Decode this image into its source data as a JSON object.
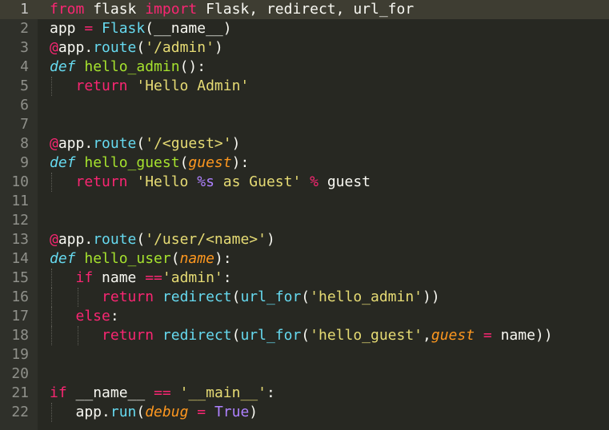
{
  "editor": {
    "active_line": 1,
    "theme_colors": {
      "background": "#272822",
      "keyword": "#f92672",
      "function": "#a6e22e",
      "string": "#e6db74",
      "builtin": "#66d9ef",
      "parameter": "#fd971f",
      "constant": "#ae81ff"
    },
    "lines": [
      {
        "n": "1",
        "indent": 0,
        "tokens": [
          [
            "kw",
            "from"
          ],
          [
            "",
            "flask"
          ],
          [
            "kw",
            "import"
          ],
          [
            "",
            "Flask, redirect, url_for"
          ]
        ]
      },
      {
        "n": "2",
        "indent": 0,
        "tokens": [
          [
            "",
            "app "
          ],
          [
            "kw",
            "="
          ],
          [
            "",
            " "
          ],
          [
            "bi",
            "Flask"
          ],
          [
            "",
            "(__name__)"
          ]
        ]
      },
      {
        "n": "3",
        "indent": 0,
        "tokens": [
          [
            "kw",
            "@"
          ],
          [
            "",
            "app."
          ],
          [
            "bi",
            "route"
          ],
          [
            "",
            "("
          ],
          [
            "st",
            "'/admin'"
          ],
          [
            "",
            ")"
          ]
        ]
      },
      {
        "n": "4",
        "indent": 0,
        "tokens": [
          [
            "ty",
            "def"
          ],
          [
            "",
            " "
          ],
          [
            "fn",
            "hello_admin"
          ],
          [
            "",
            "():"
          ]
        ]
      },
      {
        "n": "5",
        "indent": 1,
        "tokens": [
          [
            "kw",
            "return"
          ],
          [
            "",
            " "
          ],
          [
            "st",
            "'Hello Admin'"
          ]
        ]
      },
      {
        "n": "6",
        "indent": 0,
        "tokens": []
      },
      {
        "n": "7",
        "indent": 0,
        "tokens": []
      },
      {
        "n": "8",
        "indent": 0,
        "tokens": [
          [
            "kw",
            "@"
          ],
          [
            "",
            "app."
          ],
          [
            "bi",
            "route"
          ],
          [
            "",
            "("
          ],
          [
            "st",
            "'/<guest>'"
          ],
          [
            "",
            ")"
          ]
        ]
      },
      {
        "n": "9",
        "indent": 0,
        "tokens": [
          [
            "ty",
            "def"
          ],
          [
            "",
            " "
          ],
          [
            "fn",
            "hello_guest"
          ],
          [
            "",
            "("
          ],
          [
            "pa",
            "guest"
          ],
          [
            "",
            "):"
          ]
        ]
      },
      {
        "n": "10",
        "indent": 1,
        "tokens": [
          [
            "kw",
            "return"
          ],
          [
            "",
            " "
          ],
          [
            "st",
            "'Hello "
          ],
          [
            "nu",
            "%s"
          ],
          [
            "st",
            " as Guest'"
          ],
          [
            "",
            " "
          ],
          [
            "kw",
            "%"
          ],
          [
            "",
            " guest"
          ]
        ]
      },
      {
        "n": "11",
        "indent": 0,
        "tokens": []
      },
      {
        "n": "12",
        "indent": 0,
        "tokens": []
      },
      {
        "n": "13",
        "indent": 0,
        "tokens": [
          [
            "kw",
            "@"
          ],
          [
            "",
            "app."
          ],
          [
            "bi",
            "route"
          ],
          [
            "",
            "("
          ],
          [
            "st",
            "'/user/<name>'"
          ],
          [
            "",
            ")"
          ]
        ]
      },
      {
        "n": "14",
        "indent": 0,
        "tokens": [
          [
            "ty",
            "def"
          ],
          [
            "",
            " "
          ],
          [
            "fn",
            "hello_user"
          ],
          [
            "",
            "("
          ],
          [
            "pa",
            "name"
          ],
          [
            "",
            "):"
          ]
        ]
      },
      {
        "n": "15",
        "indent": 1,
        "tokens": [
          [
            "kw",
            "if"
          ],
          [
            "",
            " name "
          ],
          [
            "kw",
            "=="
          ],
          [
            "st",
            "'admin'"
          ],
          [
            "",
            ":"
          ]
        ]
      },
      {
        "n": "16",
        "indent": 2,
        "tokens": [
          [
            "kw",
            "return"
          ],
          [
            "",
            " "
          ],
          [
            "bi",
            "redirect"
          ],
          [
            "",
            "("
          ],
          [
            "bi",
            "url_for"
          ],
          [
            "",
            "("
          ],
          [
            "st",
            "'hello_admin'"
          ],
          [
            "",
            "))"
          ]
        ]
      },
      {
        "n": "17",
        "indent": 1,
        "tokens": [
          [
            "kw",
            "else"
          ],
          [
            "",
            ":"
          ]
        ]
      },
      {
        "n": "18",
        "indent": 2,
        "tokens": [
          [
            "kw",
            "return"
          ],
          [
            "",
            " "
          ],
          [
            "bi",
            "redirect"
          ],
          [
            "",
            "("
          ],
          [
            "bi",
            "url_for"
          ],
          [
            "",
            "("
          ],
          [
            "st",
            "'hello_guest'"
          ],
          [
            "",
            ","
          ],
          [
            "pa",
            "guest"
          ],
          [
            "",
            " "
          ],
          [
            "kw",
            "="
          ],
          [
            "",
            " name))"
          ]
        ]
      },
      {
        "n": "19",
        "indent": 0,
        "tokens": []
      },
      {
        "n": "20",
        "indent": 0,
        "tokens": []
      },
      {
        "n": "21",
        "indent": 0,
        "tokens": [
          [
            "kw",
            "if"
          ],
          [
            "",
            " __name__ "
          ],
          [
            "kw",
            "=="
          ],
          [
            "",
            " "
          ],
          [
            "st",
            "'__main__'"
          ],
          [
            "",
            ":"
          ]
        ]
      },
      {
        "n": "22",
        "indent": 1,
        "tokens": [
          [
            "",
            "app."
          ],
          [
            "bi",
            "run"
          ],
          [
            "",
            "("
          ],
          [
            "pa",
            "debug"
          ],
          [
            "",
            " "
          ],
          [
            "kw",
            "="
          ],
          [
            "",
            " "
          ],
          [
            "nu",
            "True"
          ],
          [
            "",
            ")"
          ]
        ]
      }
    ]
  }
}
